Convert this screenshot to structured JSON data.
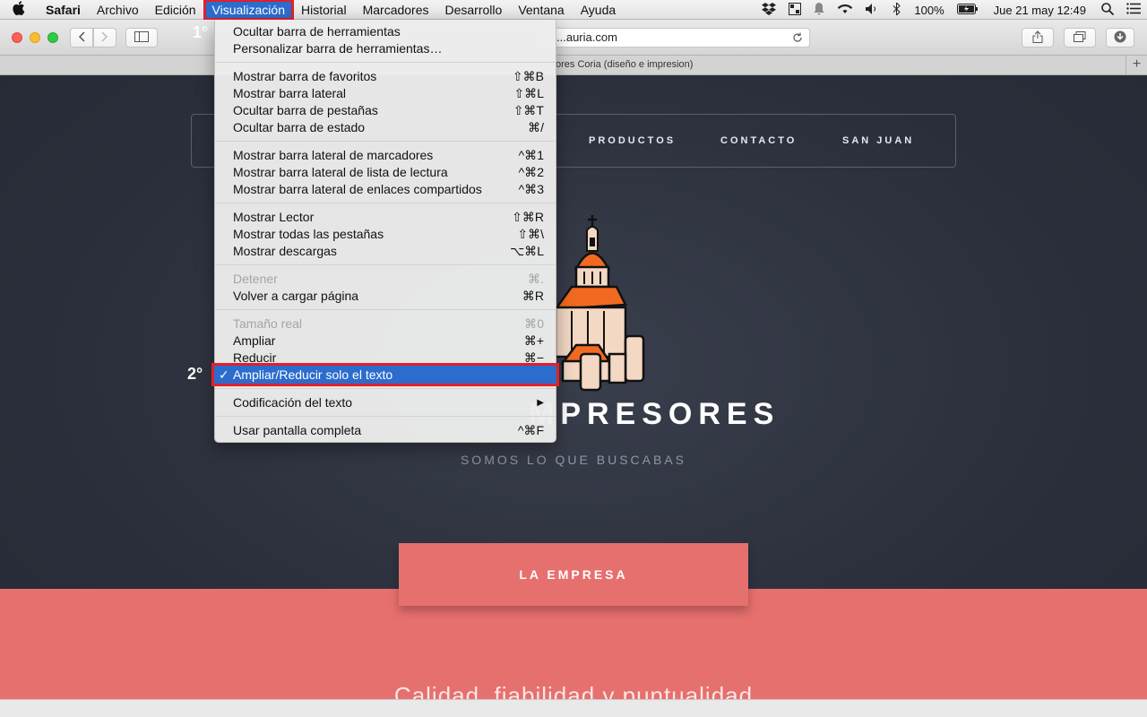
{
  "menubar": {
    "apple_icon": "apple-icon",
    "items": [
      "Safari",
      "Archivo",
      "Edición",
      "Visualización",
      "Historial",
      "Marcadores",
      "Desarrollo",
      "Ventana",
      "Ayuda"
    ],
    "battery": "100%",
    "datetime": "Jue 21 may  12:49"
  },
  "toolbar": {
    "url": "...auria.com"
  },
  "tabbar": {
    "title": "ores Coria (diseño e impresion)",
    "plus": "+"
  },
  "page": {
    "nav": [
      "PRODUCTOS",
      "CONTACTO",
      "SAN JUAN"
    ],
    "brand": "MPRESORES",
    "tagline": "SOMOS LO QUE BUSCABAS",
    "empresa": "LA EMPRESA",
    "calidad": "Calidad, fiabilidad y puntualidad"
  },
  "annotations": {
    "step1": "1°",
    "step2": "2°"
  },
  "dropdown": {
    "items": [
      {
        "label": "Ocultar barra de herramientas",
        "shortcut": ""
      },
      {
        "label": "Personalizar barra de herramientas…",
        "shortcut": ""
      },
      {
        "label": "Mostrar barra de favoritos",
        "shortcut": "⇧⌘B"
      },
      {
        "label": "Mostrar barra lateral",
        "shortcut": "⇧⌘L"
      },
      {
        "label": "Ocultar barra de pestañas",
        "shortcut": "⇧⌘T"
      },
      {
        "label": "Ocultar barra de estado",
        "shortcut": "⌘/"
      },
      {
        "label": "Mostrar barra lateral de marcadores",
        "shortcut": "^⌘1"
      },
      {
        "label": "Mostrar barra lateral de lista de lectura",
        "shortcut": "^⌘2"
      },
      {
        "label": "Mostrar barra lateral de enlaces compartidos",
        "shortcut": "^⌘3"
      },
      {
        "label": "Mostrar Lector",
        "shortcut": "⇧⌘R"
      },
      {
        "label": "Mostrar todas las pestañas",
        "shortcut": "⇧⌘\\"
      },
      {
        "label": "Mostrar descargas",
        "shortcut": "⌥⌘L"
      },
      {
        "label": "Detener",
        "shortcut": "⌘."
      },
      {
        "label": "Volver a cargar página",
        "shortcut": "⌘R"
      },
      {
        "label": "Tamaño real",
        "shortcut": "⌘0"
      },
      {
        "label": "Ampliar",
        "shortcut": "⌘+"
      },
      {
        "label": "Reducir",
        "shortcut": "⌘−"
      },
      {
        "label": "Ampliar/Reducir solo el texto",
        "shortcut": "",
        "checkmark": "✓"
      },
      {
        "label": "Codificación del texto",
        "shortcut": "▶"
      },
      {
        "label": "Usar pantalla completa",
        "shortcut": "^⌘F"
      }
    ]
  },
  "colors": {
    "menu_highlight": "#2c6ccd",
    "annotation_red": "#e0202a",
    "pink_band": "#e6706e",
    "page_bg": "#2b2f3b"
  }
}
